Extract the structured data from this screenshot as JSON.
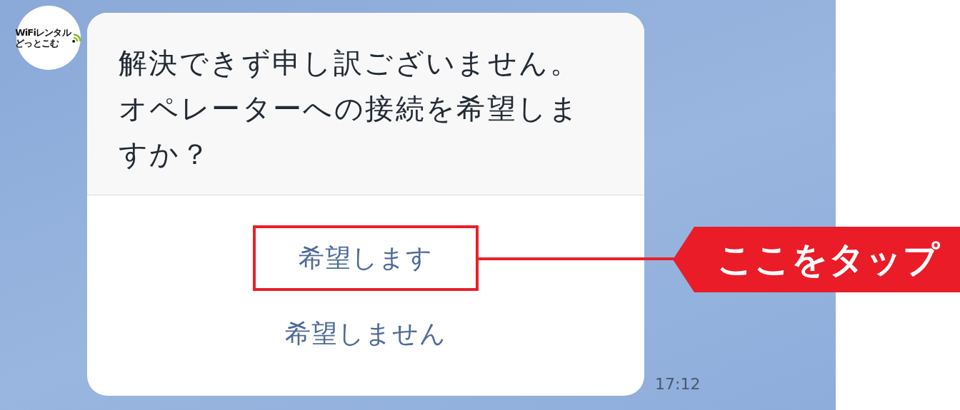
{
  "avatar": {
    "logo_lines": [
      "WiFiレンタル",
      "どっとこむ"
    ]
  },
  "message": {
    "text": "解決できず申し訳ございません。オペレーターへの接続を希望しますか？",
    "options": [
      {
        "label": "希望します",
        "highlighted": true
      },
      {
        "label": "希望しません",
        "highlighted": false
      }
    ],
    "time": "17:12"
  },
  "callout": {
    "text": "ここをタップ"
  }
}
